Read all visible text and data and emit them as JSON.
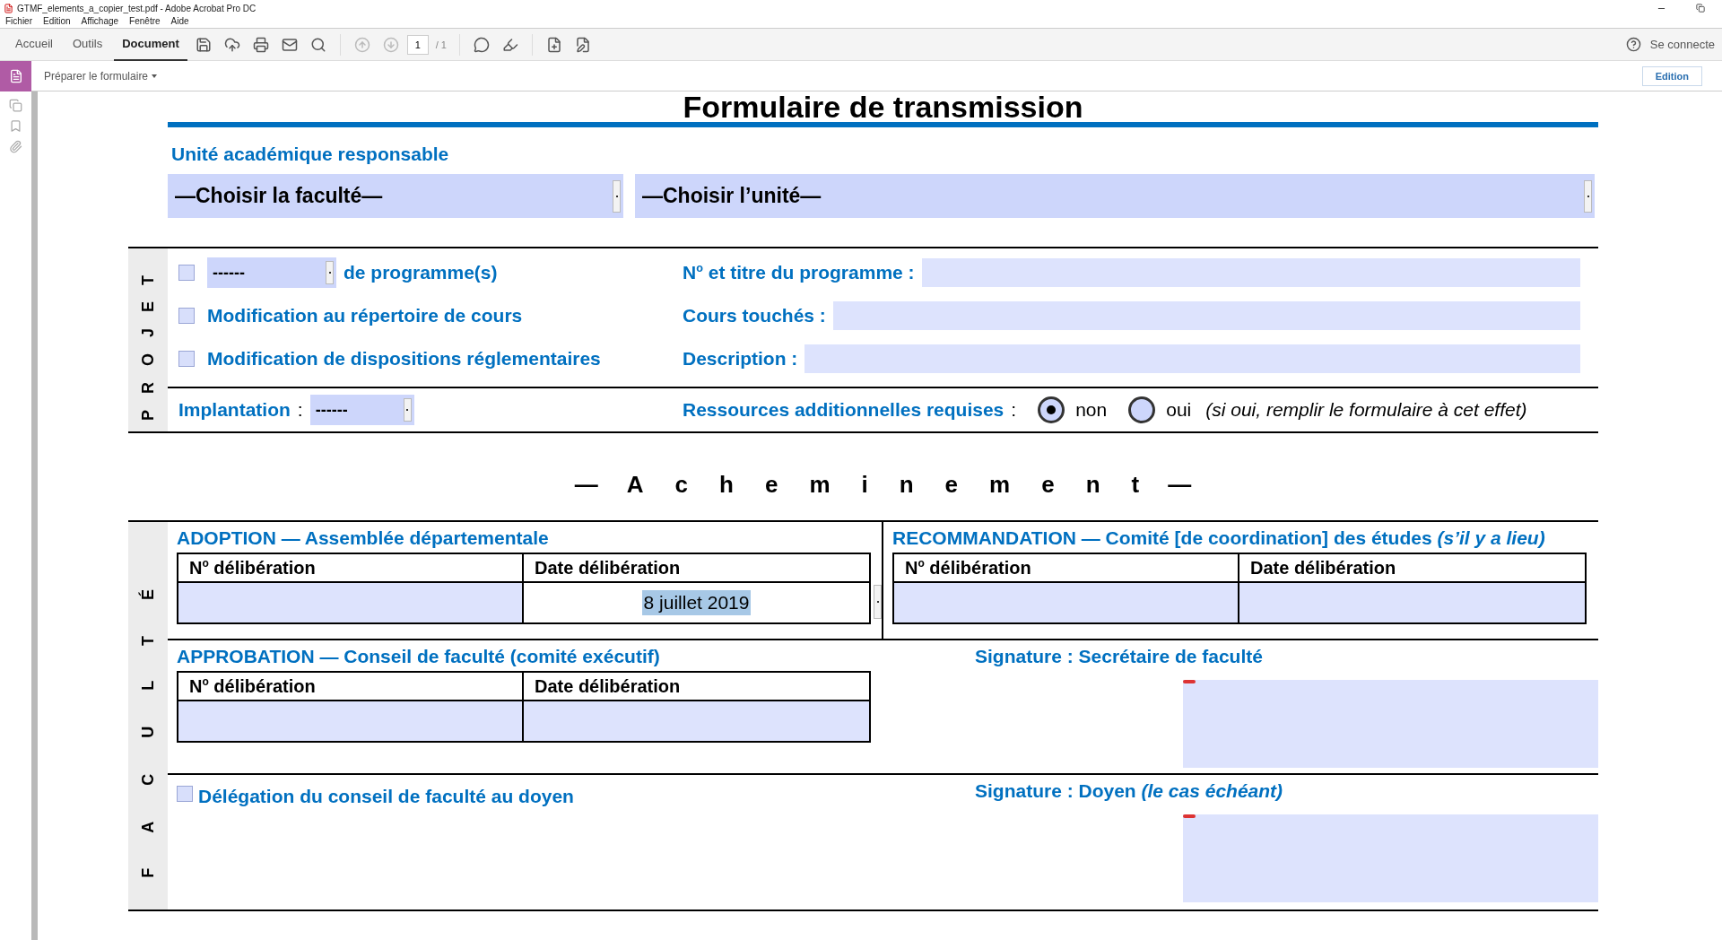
{
  "window": {
    "title": "GTMF_elements_a_copier_test.pdf - Adobe Acrobat Pro DC"
  },
  "menu": [
    "Fichier",
    "Edition",
    "Affichage",
    "Fenêtre",
    "Aide"
  ],
  "tabs": [
    {
      "label": "Accueil",
      "selected": false
    },
    {
      "label": "Outils",
      "selected": false
    },
    {
      "label": "Document",
      "selected": true
    }
  ],
  "page": {
    "current": "1",
    "total": "/ 1"
  },
  "account": {
    "signin": "Se connecte"
  },
  "tool_panel": {
    "label": "Préparer le formulaire",
    "mode_button": "Edition"
  },
  "form": {
    "title": "Formulaire de transmission",
    "unit_heading": "Unité académique responsable",
    "faculty_select": "—Choisir la faculté—",
    "unit_select": "—Choisir l’unité—",
    "projet": {
      "side_label": "PROJET",
      "rows": [
        {
          "checked": false,
          "select": "------",
          "label": "de programme(s)",
          "field_label": "N$^{o}$ et titre du programme :"
        },
        {
          "checked": false,
          "label": "Modification au répertoire de cours",
          "field_label": "Cours touchés :"
        },
        {
          "checked": false,
          "label": "Modification de dispositions réglementaires",
          "field_label": "Description :"
        }
      ],
      "implantation": {
        "label": "Implantation",
        "colon": ":",
        "select": "------"
      },
      "resources": {
        "label": "Ressources additionnelles requises",
        "colon": ":",
        "options": [
          {
            "label": "non",
            "selected": true
          },
          {
            "label": "oui",
            "selected": false
          }
        ],
        "note": "(si oui, remplir le formulaire à cet effet)"
      }
    },
    "acheminement": {
      "dash_left": "—",
      "title": "Acheminement",
      "dash_right": "—"
    },
    "faculte": {
      "side_label": "FACULTÉ",
      "adoption": {
        "title": "ADOPTION — Assemblée départementale",
        "columns": [
          "N$^{o}$ délibération",
          "Date délibération"
        ],
        "cells": [
          {
            "focused": false
          },
          {
            "focused": true,
            "value": "8 juillet 2019"
          }
        ]
      },
      "recommandation": {
        "title": "RECOMMANDATION — Comité [de coordination] des études *(s’il y a lieu)*",
        "columns": [
          "N$^{o}$ délibération",
          "Date délibération"
        ],
        "cells": [
          {
            "focused": false
          },
          {
            "focused": false
          }
        ]
      },
      "approbation": {
        "title": "APPROBATION — Conseil de faculté (comité exécutif)",
        "columns": [
          "N$^{o}$ délibération",
          "Date délibération"
        ],
        "cells": [
          {
            "focused": false
          },
          {
            "focused": false
          }
        ]
      },
      "signature_secretaire": "Signature : Secrétaire de faculté",
      "delegation": {
        "checked": false,
        "label": "Délégation du conseil de faculté au doyen"
      },
      "signature_doyen": "Signature : Doyen *(le cas échéant)*"
    }
  }
}
